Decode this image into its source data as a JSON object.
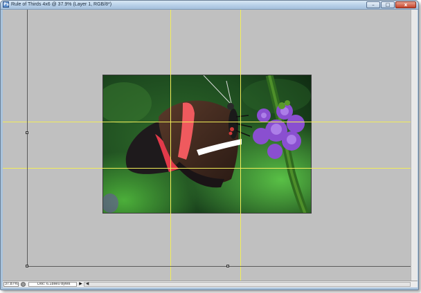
{
  "window": {
    "title": "Rule of Thirds 4x6 @ 37.9% (Layer 1, RGB/8*)",
    "app_icon": "Ps",
    "controls": {
      "minimize": "–",
      "maximize": "□",
      "close": "x"
    }
  },
  "statusbar": {
    "zoom": "37.87%",
    "doc_info": "Doc: 6.18M/0 bytes",
    "menu_arrow": "▶",
    "scroll_left": "◀"
  },
  "canvas": {
    "background_color": "#c0c0c0",
    "guide_color": "#f2ee59",
    "photo_subject": "red-postman-butterfly-on-purple-flower"
  }
}
